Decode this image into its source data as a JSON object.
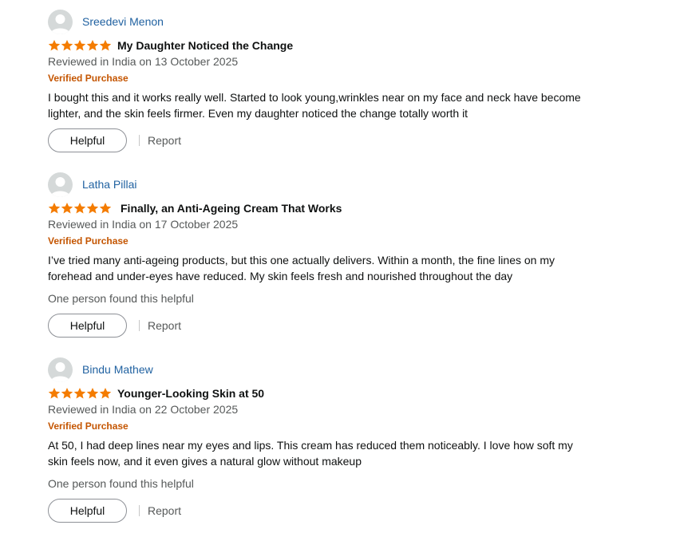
{
  "colors": {
    "star": "#f47c00",
    "name_link": "#2162a1",
    "verified": "#c45500",
    "secondary_text": "#565959"
  },
  "reviews": [
    {
      "name": "Sreedevi Menon",
      "rating": 5,
      "title": "My Daughter Noticed the Change",
      "date": "Reviewed in India on 13 October 2025",
      "verified": "Verified Purchase",
      "body": "I bought this and it works really well. Started to look young,wrinkles near on my face and neck have become lighter, and the skin feels firmer. Even my daughter noticed the change totally worth it",
      "found_helpful": "",
      "helpful_label": "Helpful",
      "report_label": "Report"
    },
    {
      "name": "Latha Pillai",
      "rating": 5,
      "title": "Finally, an Anti-Ageing Cream That Works",
      "date": "Reviewed in India on 17 October 2025",
      "verified": "Verified Purchase",
      "body": "I’ve tried many anti-ageing products, but this one actually delivers. Within a month, the fine lines on my forehead and under-eyes have reduced. My skin feels fresh and nourished throughout the day",
      "found_helpful": "One person found this helpful",
      "helpful_label": "Helpful",
      "report_label": "Report"
    },
    {
      "name": "Bindu Mathew",
      "rating": 5,
      "title": "Younger-Looking Skin at 50",
      "date": "Reviewed in India on 22 October 2025",
      "verified": "Verified Purchase",
      "body": "At 50, I had deep lines near my eyes and lips. This cream has reduced them noticeably. I love how soft my skin feels now, and it even gives a natural glow without makeup",
      "found_helpful": "One person found this helpful",
      "helpful_label": "Helpful",
      "report_label": "Report"
    }
  ]
}
